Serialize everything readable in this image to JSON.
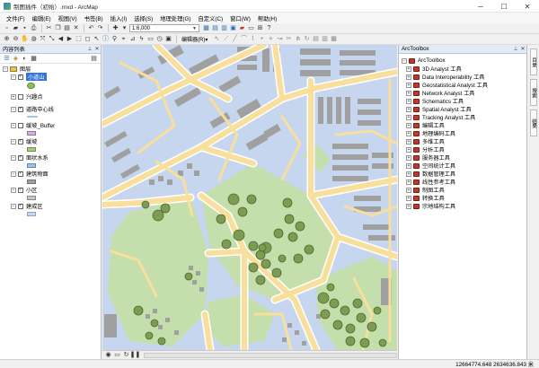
{
  "window": {
    "title": "制图插件（初始）.mxd - ArcMap",
    "minimize": "─",
    "maximize": "☐",
    "close": "✕"
  },
  "menu": [
    "文件(F)",
    "编辑(E)",
    "视图(V)",
    "书签(B)",
    "插入(I)",
    "选择(S)",
    "地理处理(G)",
    "自定义(C)",
    "窗口(W)",
    "帮助(H)"
  ],
  "toolbar": {
    "scale": "1:6,000",
    "editor_label": "编辑器(R)▾"
  },
  "toc": {
    "title": "内容列表",
    "root_label": "图层",
    "layers": [
      {
        "label": "小道山",
        "checked": true,
        "selected": true,
        "symbol": "polygon",
        "color": "#8fbf5a"
      },
      {
        "label": "兴趣点",
        "checked": false,
        "symbol": "none"
      },
      {
        "label": "道路中心线",
        "checked": true,
        "symbol": "line",
        "color": "#a6c3e8"
      },
      {
        "label": "缓坡_Buffer",
        "checked": false,
        "symbol": "polygon",
        "color": "#d9b0e0"
      },
      {
        "label": "缓坡",
        "checked": true,
        "symbol": "polygon",
        "color": "#a9c98a"
      },
      {
        "label": "面状水系",
        "checked": true,
        "symbol": "polygon",
        "color": "#9fc3e7"
      },
      {
        "label": "建筑物面",
        "checked": true,
        "symbol": "polygon",
        "color": "#a0a0a0"
      },
      {
        "label": "小区",
        "checked": true,
        "symbol": "polygon",
        "color": "#c8c8c8"
      },
      {
        "label": "建成区",
        "checked": true,
        "symbol": "polygon",
        "color": "#c7d6ef"
      }
    ]
  },
  "arctoolbox": {
    "title": "ArcToolbox",
    "root_label": "ArcToolbox",
    "tools": [
      "3D Analyst 工具",
      "Data Interoperability 工具",
      "Geostatistical Analyst 工具",
      "Network Analyst 工具",
      "Schematics 工具",
      "Spatial Analyst 工具",
      "Tracking Analyst 工具",
      "编辑工具",
      "地理编码工具",
      "多维工具",
      "分析工具",
      "服务器工具",
      "空间统计工具",
      "数据管理工具",
      "线性参考工具",
      "制图工具",
      "转换工具",
      "宗地结构工具"
    ]
  },
  "side_tabs": [
    "目录",
    "搜索",
    "结果"
  ],
  "status": {
    "coordinates": "12664774.648  2634636.843 米"
  },
  "colors": {
    "map_background": "#c7d6ef",
    "road": "#f8df9b",
    "road_casing": "#ffffff",
    "building": "#a0a0a0",
    "green": "#c4dfab",
    "tree": "#7d9b52",
    "panel_header": "#e3ebf5",
    "toolbox_icon": "#c0392b"
  }
}
